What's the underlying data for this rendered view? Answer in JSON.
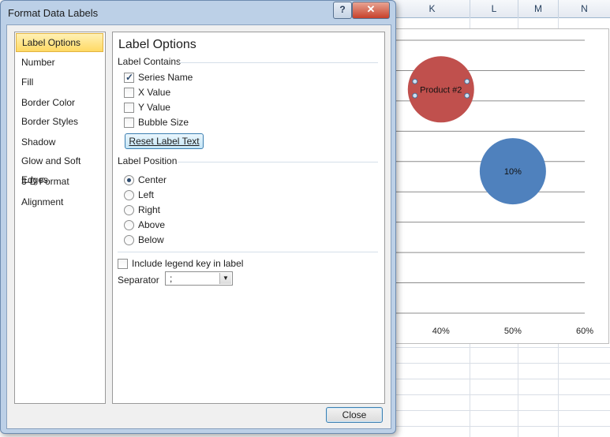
{
  "window": {
    "title": "Format Data Labels",
    "help_label": "?",
    "close_label": "✕"
  },
  "spreadsheet": {
    "columns": [
      "K",
      "L",
      "M",
      "N"
    ]
  },
  "sidebar": {
    "items": [
      {
        "label": "Label Options",
        "selected": true
      },
      {
        "label": "Number"
      },
      {
        "label": "Fill"
      },
      {
        "label": "Border Color"
      },
      {
        "label": "Border Styles"
      },
      {
        "label": "Shadow"
      },
      {
        "label": "Glow and Soft Edges"
      },
      {
        "label": "3-D Format"
      },
      {
        "label": "Alignment"
      }
    ]
  },
  "panel": {
    "title": "Label Options",
    "label_contains": {
      "heading": "Label Contains",
      "options": [
        {
          "label": "Series Name",
          "checked": true
        },
        {
          "label": "X Value",
          "checked": false
        },
        {
          "label": "Y Value",
          "checked": false
        },
        {
          "label": "Bubble Size",
          "checked": false
        }
      ],
      "reset_label": "Reset Label Text"
    },
    "label_position": {
      "heading": "Label Position",
      "options": [
        {
          "label": "Center",
          "selected": true
        },
        {
          "label": "Left",
          "selected": false
        },
        {
          "label": "Right",
          "selected": false
        },
        {
          "label": "Above",
          "selected": false
        },
        {
          "label": "Below",
          "selected": false
        }
      ]
    },
    "legend_key_label": "Include legend key in label",
    "legend_key_checked": false,
    "separator_label": "Separator",
    "separator_value": ";"
  },
  "footer": {
    "close_label": "Close"
  },
  "chart_data": {
    "type": "scatter",
    "x_ticks": [
      "40%",
      "50%",
      "60%"
    ],
    "xlim": [
      0.33,
      0.6
    ],
    "ylim": [
      0,
      10
    ],
    "grid": true,
    "series": [
      {
        "label": "Product #2",
        "x": 0.4,
        "y": 8.2,
        "color": "#c0504d"
      },
      {
        "label": "10%",
        "x": 0.5,
        "y": 5.2,
        "color": "#4f81bd"
      }
    ]
  }
}
